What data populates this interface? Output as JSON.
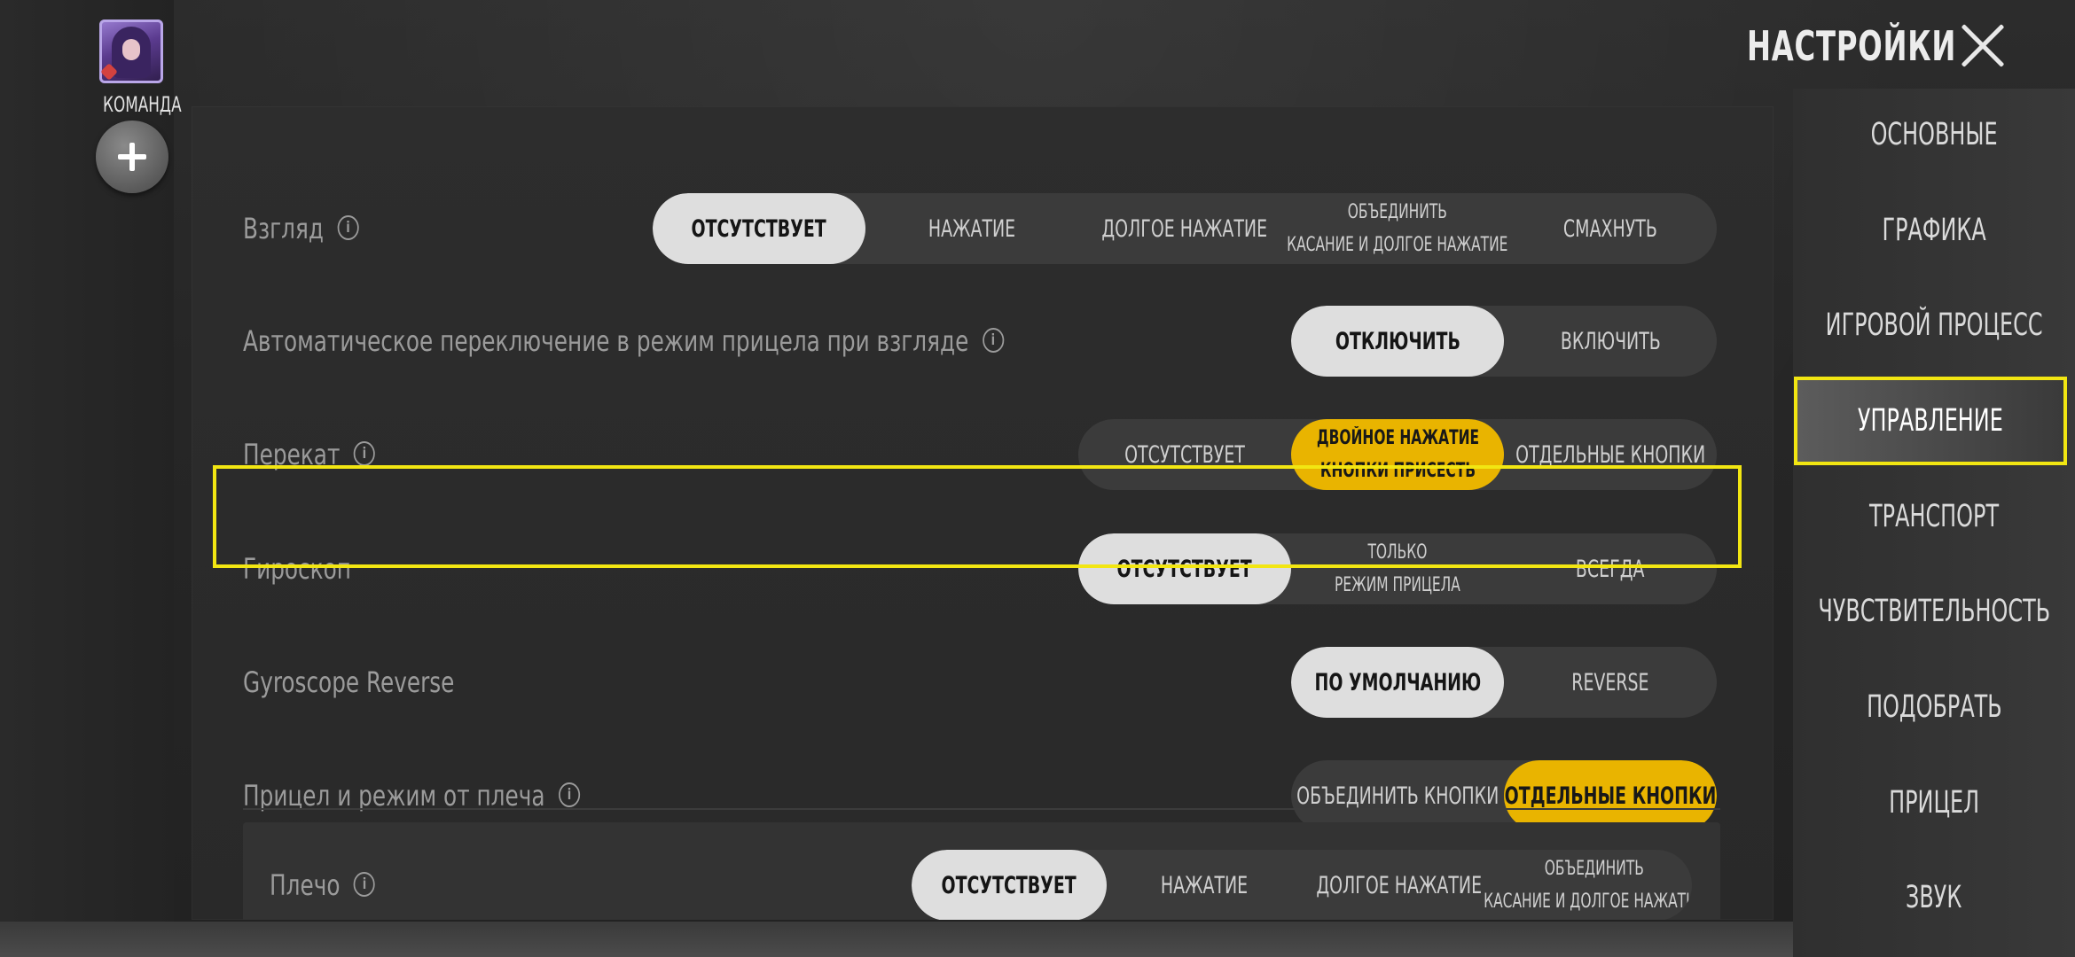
{
  "header": {
    "title": "НАСТРОЙКИ"
  },
  "team": {
    "label": "КОМАНДА"
  },
  "settings": [
    {
      "label": "Взгляд",
      "info": true,
      "options": [
        "ОТСУТСТВУЕТ",
        "НАЖАТИЕ",
        "ДОЛГОЕ НАЖАТИЕ",
        "ОБЪЕДИНИТЬ\nКАСАНИЕ И ДОЛГОЕ НАЖАТИЕ",
        "СМАХНУТЬ"
      ],
      "selected": "ОТСУТСТВУЕТ"
    },
    {
      "label": "Автоматическое переключение в режим прицела при взгляде",
      "info": true,
      "options": [
        "ОТКЛЮЧИТЬ",
        "ВКЛЮЧИТЬ"
      ],
      "selected": "ОТКЛЮЧИТЬ"
    },
    {
      "label": "Перекат",
      "info": true,
      "options": [
        "ОТСУТСТВУЕТ",
        "ДВОЙНОЕ НАЖАТИЕ\nКНОПКИ ПРИСЕСТЬ",
        "ОТДЕЛЬНЫЕ КНОПКИ"
      ],
      "selected": "ДВОЙНОЕ НАЖАТИЕ\nКНОПКИ ПРИСЕСТЬ"
    },
    {
      "label": "Гироскоп",
      "info": false,
      "options": [
        "ОТСУТСТВУЕТ",
        "ТОЛЬКО\nРЕЖИМ ПРИЦЕЛА",
        "ВСЕГДА"
      ],
      "selected": "ОТСУТСТВУЕТ"
    },
    {
      "label": "Gyroscope Reverse",
      "info": false,
      "options": [
        "ПО УМОЛЧАНИЮ",
        "REVERSE"
      ],
      "selected": "ПО УМОЛЧАНИЮ"
    },
    {
      "label": "Прицел и режим от плеча",
      "info": true,
      "options": [
        "ОБЪЕДИНИТЬ КНОПКИ",
        "ОТДЕЛЬНЫЕ КНОПКИ"
      ],
      "selected": "ОТДЕЛЬНЫЕ КНОПКИ"
    },
    {
      "label": "Плечо",
      "info": true,
      "options": [
        "ОТСУТСТВУЕТ",
        "НАЖАТИЕ",
        "ДОЛГОЕ НАЖАТИЕ",
        "ОБЪЕДИНИТЬ\nКАСАНИЕ И ДОЛГОЕ НАЖАТИЕ"
      ],
      "selected": "ОТСУТСТВУЕТ"
    }
  ],
  "nav": {
    "items": [
      "ОСНОВНЫЕ",
      "ГРАФИКА",
      "ИГРОВОЙ ПРОЦЕСС",
      "УПРАВЛЕНИЕ",
      "ТРАНСПОРТ",
      "ЧУВСТВИТЕЛЬНОСТЬ",
      "ПОДОБРАТЬ",
      "ПРИЦЕЛ",
      "ЗВУК"
    ],
    "active": "УПРАВЛЕНИЕ"
  },
  "colors": {
    "accent": "#e9b400",
    "highlight": "#f2e612",
    "selected_grey": "#dedede"
  },
  "icons": {
    "close": "close-icon",
    "add": "plus-icon",
    "info": "info-icon"
  }
}
